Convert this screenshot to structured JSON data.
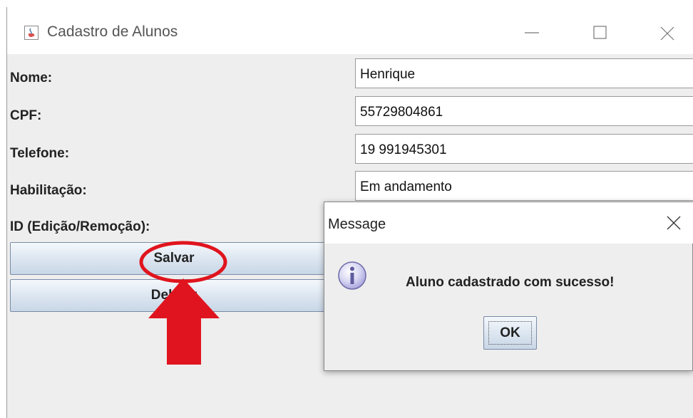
{
  "window": {
    "title": "Cadastro de Alunos"
  },
  "form": {
    "nome_label": "Nome:",
    "nome_value": "Henrique",
    "cpf_label": "CPF:",
    "cpf_value": "55729804861",
    "telefone_label": "Telefone:",
    "telefone_value": "19 991945301",
    "habilitacao_label": "Habilitação:",
    "habilitacao_value": "Em andamento",
    "id_label": "ID (Edição/Remoção):"
  },
  "buttons": {
    "salvar": "Salvar",
    "deletar": "Deletar"
  },
  "dialog": {
    "title": "Message",
    "message": "Aluno cadastrado com sucesso!",
    "ok_label": "OK"
  },
  "icons": {
    "app": "java-cup-icon",
    "minimize": "minimize-icon",
    "maximize": "maximize-icon",
    "close": "close-icon",
    "info": "info-icon"
  },
  "colors": {
    "annotation_red": "#e0141e",
    "window_bg": "#eeeeee",
    "button_gradient_bottom": "#c8d6e6"
  }
}
